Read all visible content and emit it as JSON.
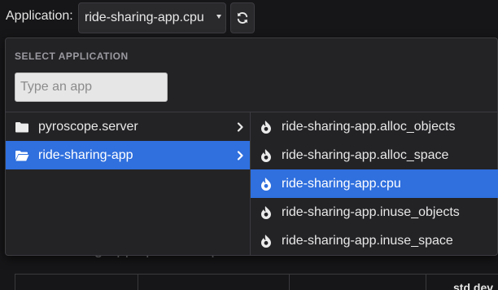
{
  "toolbar": {
    "label": "Application:",
    "selected_app": "ride-sharing-app.cpu",
    "refresh_icon": "refresh-icon"
  },
  "dropdown": {
    "title": "SELECT APPLICATION",
    "search_placeholder": "Type an app",
    "search_value": "",
    "groups": [
      {
        "label": "pyroscope.server",
        "icon": "folder-icon",
        "selected": false
      },
      {
        "label": "ride-sharing-app",
        "icon": "folder-open-icon",
        "selected": true
      }
    ],
    "apps": [
      {
        "label": "ride-sharing-app.alloc_objects",
        "icon": "flame-icon",
        "selected": false
      },
      {
        "label": "ride-sharing-app.alloc_space",
        "icon": "flame-icon",
        "selected": false
      },
      {
        "label": "ride-sharing-app.cpu",
        "icon": "flame-icon",
        "selected": true
      },
      {
        "label": "ride-sharing-app.inuse_objects",
        "icon": "flame-icon",
        "selected": false
      },
      {
        "label": "ride-sharing-app.inuse_space",
        "icon": "flame-icon",
        "selected": false
      }
    ]
  },
  "background": {
    "heading": "ride-sharing-app.cpu Descriptive Statistics",
    "table_header_last": "std dev"
  },
  "colors": {
    "page_bg": "#161618",
    "panel_bg": "#232326",
    "accent": "#2f6fde"
  }
}
